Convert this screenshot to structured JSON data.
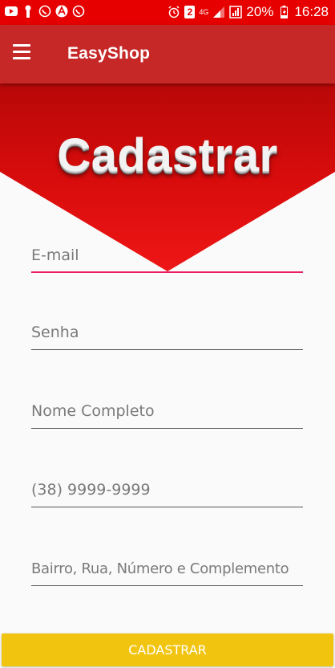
{
  "status_bar": {
    "battery": "20%",
    "time": "16:28",
    "sim_slot": "2",
    "network": "4G",
    "left_icons": [
      "youtube-icon",
      "notification-icon",
      "whatsapp-icon",
      "pdf-icon",
      "whatsapp-icon"
    ],
    "right_icons": [
      "alarm-icon",
      "sim-icon",
      "signal-icon",
      "battery-icon"
    ]
  },
  "app_bar": {
    "title": "EasyShop",
    "menu_icon": "hamburger-menu-icon"
  },
  "banner": {
    "title": "Cadastrar"
  },
  "form": {
    "email_placeholder": "E-mail",
    "password_placeholder": "Senha",
    "name_placeholder": "Nome Completo",
    "phone_placeholder": "(38) 9999-9999",
    "address_placeholder": "Bairro, Rua, Número e Complemento"
  },
  "submit": {
    "label": "CADASTRAR"
  },
  "colors": {
    "status_bar": "#e60000",
    "app_bar": "#c62828",
    "banner": "#d80c0c",
    "focus_underline": "#e91e63",
    "button": "#f1c40f"
  }
}
